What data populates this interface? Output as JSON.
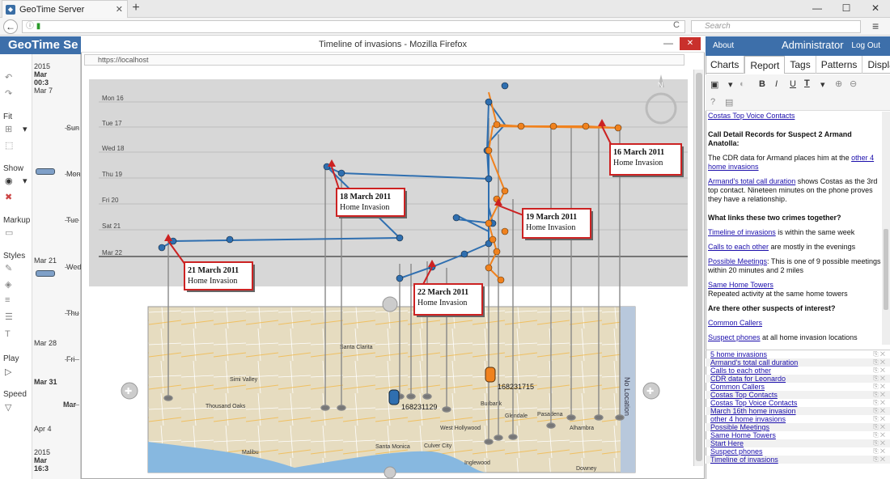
{
  "browser": {
    "tab_title": "GeoTime Server",
    "new_tab": "+",
    "min_icon": "—",
    "max_icon": "☐",
    "close_icon": "✕",
    "back_icon": "←",
    "url_placeholder": "",
    "search_placeholder": "Search",
    "reload_icon": "C",
    "menu_icon": "≡"
  },
  "app": {
    "title": "GeoTime Se",
    "tools": {
      "fit": "Fit",
      "show": "Show",
      "markup": "Markup",
      "styles": "Styles",
      "play": "Play",
      "speed": "Speed"
    },
    "ruler": {
      "top_year": "2015",
      "top_month": "Mar",
      "top_time": "00:3",
      "labels": [
        "Mar 7",
        "Sun",
        "Mon",
        "Tue",
        "Mar 21",
        "Wed",
        "Thu",
        "Mar 28",
        "Fri",
        "Mar 31",
        "Mar",
        "Apr 4"
      ],
      "bottom_year": "2015",
      "bottom_month": "Mar",
      "bottom_time": "16:3"
    }
  },
  "popup": {
    "title": "Timeline of invasions - Mozilla Firefox",
    "url": "https://localhost",
    "close_icon": "✕",
    "min_icon": "—",
    "time_axis": [
      "Mon 16",
      "Tue 17",
      "Wed 18",
      "Thu 19",
      "Fri 20",
      "Sat 21",
      "Mar 22"
    ],
    "annotations": [
      {
        "date": "16 March 2011",
        "text": "Home Invasion"
      },
      {
        "date": "18 March 2011",
        "text": "Home Invasion"
      },
      {
        "date": "19 March 2011",
        "text": "Home Invasion"
      },
      {
        "date": "21 March 2011",
        "text": "Home Invasion"
      },
      {
        "date": "22 March 2011",
        "text": "Home Invasion"
      }
    ],
    "map_labels": [
      "Santa Clarita",
      "Simi Valley",
      "Thousand Oaks",
      "Burbank",
      "Glendale",
      "Pasadena",
      "West Hollywood",
      "Santa Monica",
      "Culver City",
      "Inglewood",
      "Malibu",
      "Alhambra",
      "Downey"
    ],
    "phone_labels": [
      "168231129",
      "168231715"
    ],
    "no_location": "No Location",
    "compass": "N"
  },
  "panel": {
    "about": "About",
    "user": "Administrator",
    "logout": "Log Out",
    "tabs": [
      "Charts",
      "Report",
      "Tags",
      "Patterns",
      "Display"
    ],
    "active_tab": "Report",
    "toolbar": {
      "bold": "B",
      "italic": "I",
      "underline": "U",
      "text": "T"
    },
    "report": {
      "link_top": "Costas Top Voice Contacts",
      "h_cdr": "Call Detail Records for Suspect 2 Armand Anatolla:",
      "p1_pre": "The CDR data for Armand places him at the ",
      "p1_link": "other 4 home invasions",
      "p2_link": "Armand's total call duration",
      "p2_text": " shows Costas as the 3rd top contact. Nineteen minutes on the phone proves they have a relationship.",
      "h_links": "What links these two crimes together?",
      "p3_link": "Timeline of invasions",
      "p3_text": " is within the same week",
      "p4_link": "Calls to each other",
      "p4_text": " are mostly in the evenings",
      "p5_link": "Possible Meetings",
      "p5_text": ": This is one of 9 possible meetings within 20 minutes and 2 miles",
      "p6_link": "Same Home Towers",
      "p6_text": "Repeated activity at the same home towers",
      "h_other": "Are there other suspects of interest?",
      "p7_link": "Common Callers",
      "p8_link": "Suspect phones",
      "p8_text": " at all home invasion locations"
    },
    "links": [
      "5 home invasions",
      "Armand's total call duration",
      "Calls to each other",
      "CDR data for Leonardo",
      "Common Callers",
      "Costas Top Contacts",
      "Costas Top Voice Contacts",
      "March 16th home invasion",
      "other 4 home invasions",
      "Possible Meetings",
      "Same Home Towers",
      "Start Here",
      "Suspect phones",
      "Timeline of invasions"
    ]
  },
  "colors": {
    "accent": "#3d6faa",
    "blue_track": "#2f6fb0",
    "orange_track": "#f0821e",
    "callout": "#cc2222"
  }
}
